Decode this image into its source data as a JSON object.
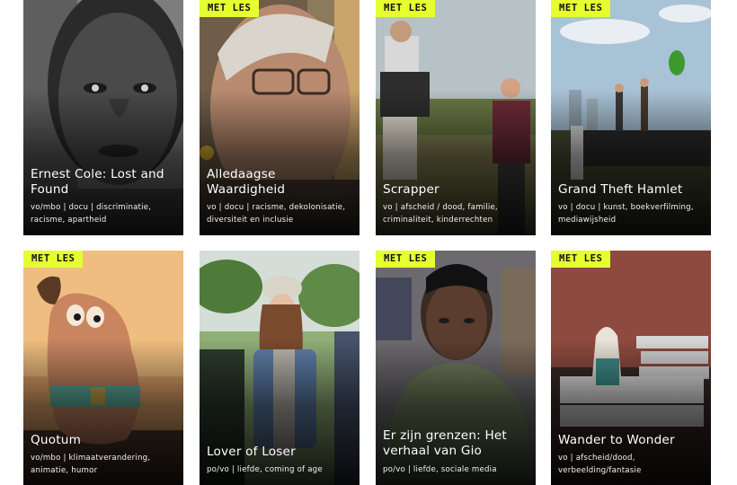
{
  "colors": {
    "badge_bg": "#e6ff2e"
  },
  "cards": [
    {
      "title": "Ernest Cole: Lost and Found",
      "meta": "vo/mbo | docu | discriminatie, racisme, apartheid",
      "badge": ""
    },
    {
      "title": "Alledaagse Waardigheid",
      "meta": "vo | docu | racisme, dekolonisatie, diversiteit en inclusie",
      "badge": "MET LES"
    },
    {
      "title": "Scrapper",
      "meta": "vo | afscheid / dood, familie, criminaliteit, kinderrechten",
      "badge": "MET LES"
    },
    {
      "title": "Grand Theft Hamlet",
      "meta": "vo | docu | kunst, boekverfilming, mediawijsheid",
      "badge": "MET LES"
    },
    {
      "title": "Quotum",
      "meta": "vo/mbo | klimaatverandering, animatie, humor",
      "badge": "MET LES"
    },
    {
      "title": "Lover of Loser",
      "meta": "po/vo | liefde, coming of age",
      "badge": ""
    },
    {
      "title": "Er zijn grenzen: Het verhaal van Gio",
      "meta": "po/vo | liefde, sociale media",
      "badge": "MET LES"
    },
    {
      "title": "Wander to Wonder",
      "meta": "vo | afscheid/dood, verbeelding/fantasie",
      "badge": "MET LES"
    }
  ]
}
